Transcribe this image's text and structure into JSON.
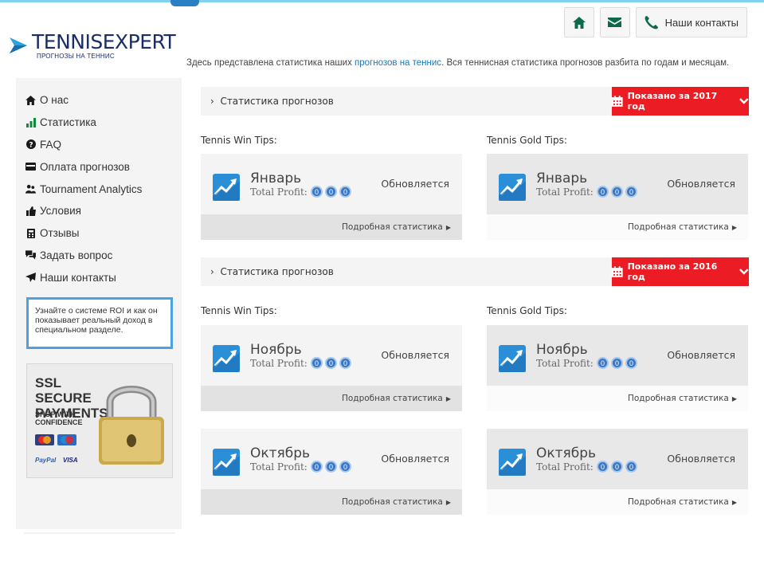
{
  "brand": {
    "wordmark": "TENNISEXPERT",
    "tagline": "ПРОГНОЗЫ НА ТЕННИС"
  },
  "header": {
    "contacts_label": "Наши контакты"
  },
  "intro": {
    "before": "Здесь представлена статистика наших ",
    "link": "прогнозов на теннис",
    "after": ". Вся теннисная статистика прогнозов разбита по годам и месяцам."
  },
  "sidebar": {
    "items": [
      {
        "label": "О нас",
        "icon": "home-icon"
      },
      {
        "label": "Статистика",
        "icon": "bar-chart-icon"
      },
      {
        "label": "FAQ",
        "icon": "question-icon"
      },
      {
        "label": "Оплата прогнозов",
        "icon": "credit-card-icon"
      },
      {
        "label": "Tournament Analytics",
        "icon": "users-icon"
      },
      {
        "label": "Условия",
        "icon": "thumbs-up-icon"
      },
      {
        "label": "Отзывы",
        "icon": "calculator-icon"
      },
      {
        "label": "Задать вопрос",
        "icon": "comments-icon"
      },
      {
        "label": "Наши контакты",
        "icon": "send-icon"
      }
    ],
    "roi_text": "Узнайте о системе ROI и как он показывает реальный доход в специальном разделе.",
    "ssl": {
      "title": "SSL SECURE PAYMENTS",
      "subtitle": "SHOP WITH CONFIDENCE",
      "paypal": "PayPal",
      "visa": "VISA"
    }
  },
  "sections": [
    {
      "title": "Статистика прогнозов",
      "year_button": "Показано за 2017 год",
      "left_heading": "Tennis Win Tips:",
      "right_heading": "Tennis Gold Tips:"
    },
    {
      "title": "Статистика прогнозов",
      "year_button": "Показано за 2016 год",
      "left_heading": "Tennis Win Tips:",
      "right_heading": "Tennis Gold Tips:"
    }
  ],
  "cards": {
    "jan_left": {
      "month": "Январь",
      "profit_label": "Total Profit:",
      "dots": [
        "0",
        "0",
        "0"
      ],
      "status": "Обновляется",
      "footer": "Подробная статистика"
    },
    "jan_right": {
      "month": "Январь",
      "profit_label": "Total Profit:",
      "dots": [
        "0",
        "0",
        "0"
      ],
      "status": "Обновляется",
      "footer": "Подробная статистика"
    },
    "nov_left": {
      "month": "Ноябрь",
      "profit_label": "Total Profit:",
      "dots": [
        "0",
        "0",
        "0"
      ],
      "status": "Обновляется",
      "footer": "Подробная статистика"
    },
    "nov_right": {
      "month": "Ноябрь",
      "profit_label": "Total Profit:",
      "dots": [
        "0",
        "0",
        "0"
      ],
      "status": "Обновляется",
      "footer": "Подробная статистика"
    },
    "oct_left": {
      "month": "Октябрь",
      "profit_label": "Total Profit:",
      "dots": [
        "0",
        "0",
        "0"
      ],
      "status": "Обновляется",
      "footer": "Подробная статистика"
    },
    "oct_right": {
      "month": "Октябрь",
      "profit_label": "Total Profit:",
      "dots": [
        "0",
        "0",
        "0"
      ],
      "status": "Обновляется",
      "footer": "Подробная статистика"
    }
  },
  "colors": {
    "accent_red": "#ec1c24",
    "accent_green": "#0e6a4c",
    "link_blue": "#1d78b6",
    "dot_blue": "#3a78c6"
  }
}
